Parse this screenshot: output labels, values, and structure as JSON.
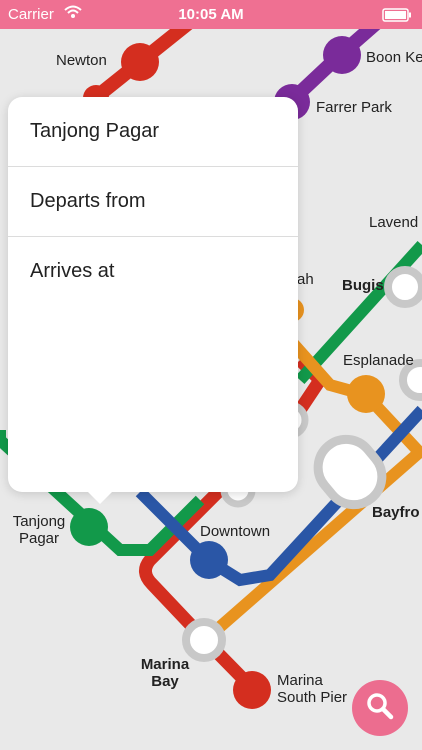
{
  "status_bar": {
    "carrier": "Carrier",
    "time": "10:05 AM"
  },
  "popover": {
    "title": "Tanjong Pagar",
    "items": [
      {
        "label": "Departs from"
      },
      {
        "label": "Arrives at"
      }
    ]
  },
  "stations": {
    "newton": "Newton",
    "boon_keng": "Boon Ke",
    "farrer_park": "Farrer Park",
    "lavender": "Lavend",
    "bugis": "Bugis",
    "rochor_partial": "ah",
    "esplanade": "Esplanade",
    "bayfront": "Bayfro",
    "tanjong_pagar_line1": "Tanjong",
    "tanjong_pagar_line2": "Pagar",
    "downtown": "Downtown",
    "marina_bay_line1": "Marina",
    "marina_bay_line2": "Bay",
    "marina_south_pier_line1": "Marina",
    "marina_south_pier_line2": "South Pier"
  },
  "colors": {
    "status_bar": "#ef7092",
    "red_line": "#d42e1f",
    "purple_line": "#7a2b9a",
    "green_line": "#12994a",
    "orange_line": "#e8931f",
    "blue_line": "#2a56a6",
    "interchange": "#c8c8c8",
    "search_button": "#ec6d8f"
  },
  "icons": {
    "wifi": "wifi-icon",
    "battery": "battery-icon",
    "search": "search-icon"
  }
}
